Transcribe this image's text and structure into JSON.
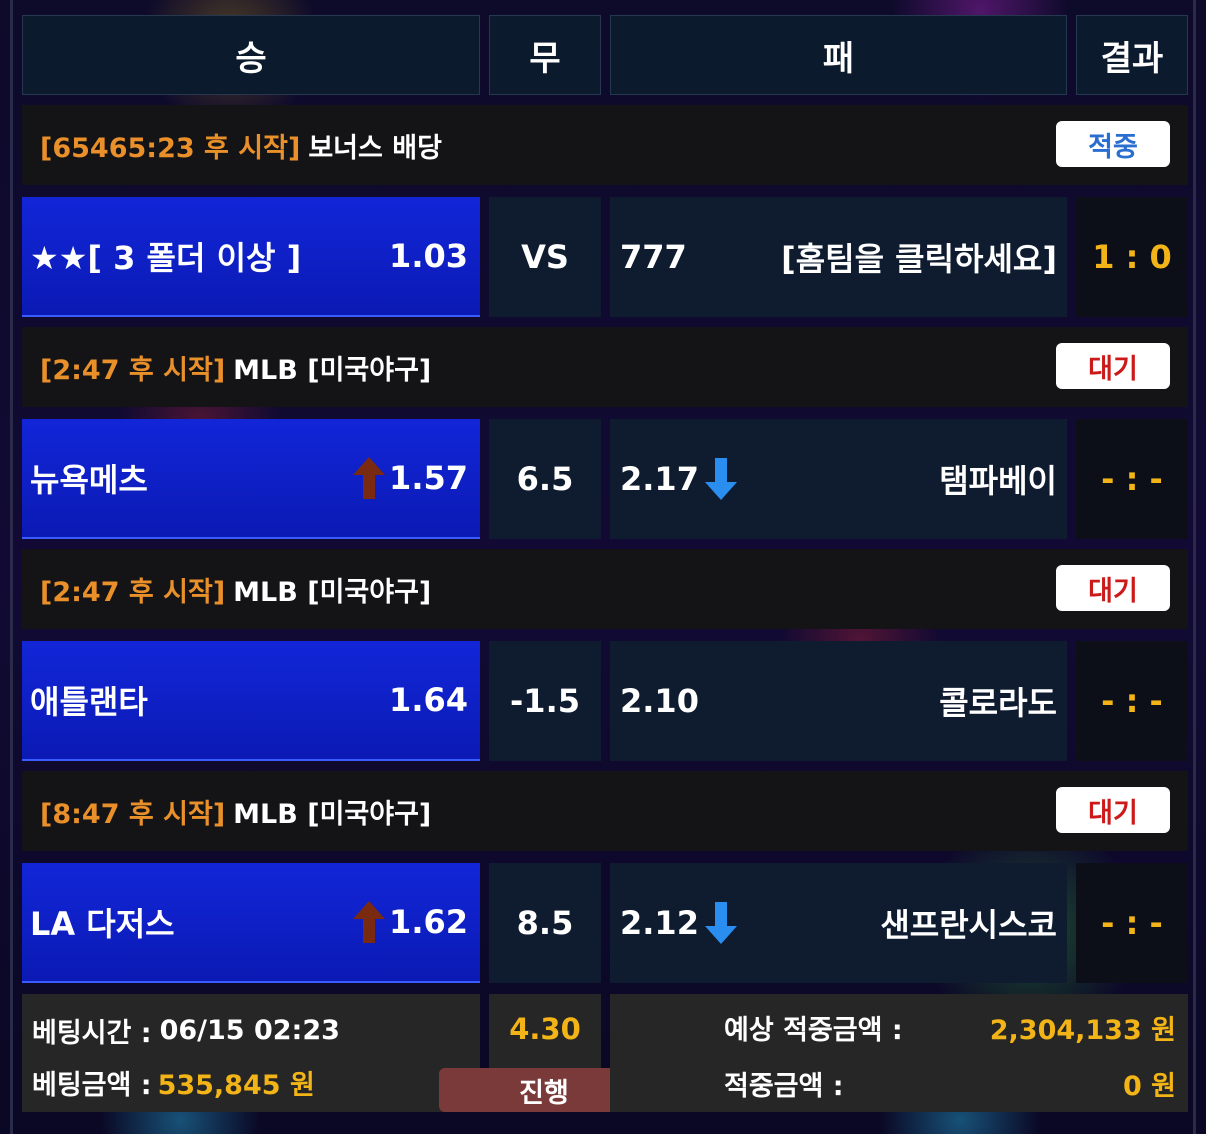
{
  "header": {
    "win": "승",
    "draw": "무",
    "lose": "패",
    "result": "결과"
  },
  "games": [
    {
      "time": "[65465:23 후 시작]",
      "league": "보너스 배당",
      "status": "적중",
      "status_type": "hit",
      "home": "★★[ 3 폴더 이상 ]",
      "home_odds": "1.03",
      "home_trend": "",
      "draw": "VS",
      "away_odds": "777",
      "away_trend": "",
      "away": "[홈팀을 클릭하세요]",
      "score": "1 : 0"
    },
    {
      "time": "[2:47 후 시작]",
      "league": "MLB [미국야구]",
      "status": "대기",
      "status_type": "wait",
      "home": "뉴욕메츠",
      "home_odds": "1.57",
      "home_trend": "up-arrow-icon",
      "draw": "6.5",
      "away_odds": "2.17",
      "away_trend": "down-arrow-icon",
      "away": "탬파베이",
      "score": "- : -"
    },
    {
      "time": "[2:47 후 시작]",
      "league": "MLB [미국야구]",
      "status": "대기",
      "status_type": "wait",
      "home": "애틀랜타",
      "home_odds": "1.64",
      "home_trend": "",
      "draw": "-1.5",
      "away_odds": "2.10",
      "away_trend": "",
      "away": "콜로라도",
      "score": "- : -"
    },
    {
      "time": "[8:47 후 시작]",
      "league": "MLB [미국야구]",
      "status": "대기",
      "status_type": "wait",
      "home": "LA 다저스",
      "home_odds": "1.62",
      "home_trend": "up-arrow-icon",
      "draw": "8.5",
      "away_odds": "2.12",
      "away_trend": "down-arrow-icon",
      "away": "샌프란시스코",
      "score": "- : -"
    }
  ],
  "footer": {
    "bet_time_label": "베팅시간 :",
    "bet_time": "06/15 02:23",
    "bet_amount_label": "베팅금액 :",
    "bet_amount": "535,845 원",
    "total_odds": "4.30",
    "status": "진행",
    "expected_label": "예상 적중금액 :",
    "expected_amount": "2,304,133 원",
    "win_label": "적중금액 :",
    "win_amount": "0 원"
  },
  "colors": {
    "accent_orange": "#e9902a",
    "accent_yellow": "#f2b417",
    "home_blue": "#1226d8",
    "hit_blue": "#2a6fd0",
    "wait_red": "#cc1a1a",
    "arrow_up": "#7a2a10",
    "arrow_down": "#2a8ef0"
  }
}
